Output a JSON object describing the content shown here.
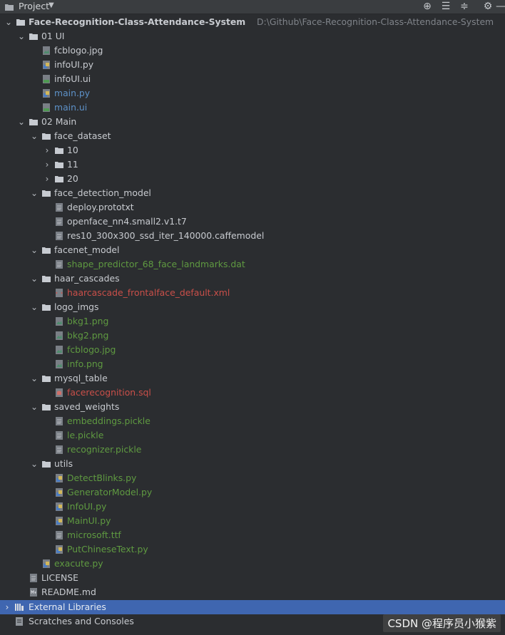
{
  "header": {
    "title": "Project"
  },
  "colors": {
    "background": "#2b2d30",
    "selection": "#3f66b0",
    "green": "#5f9a41",
    "blue": "#5d91c8",
    "red": "#c94f49"
  },
  "tree": [
    {
      "label": "Face-Recognition-Class-Attendance-System",
      "path": "D:\\Github\\Face-Recognition-Class-Attendance-System",
      "indent": 0,
      "type": "folder",
      "arrow": "down",
      "bold": true,
      "color": "default",
      "icon": "folder-icon"
    },
    {
      "label": "01 UI",
      "indent": 1,
      "type": "folder",
      "arrow": "down",
      "color": "default",
      "icon": "folder-icon"
    },
    {
      "label": "fcblogo.jpg",
      "indent": 2,
      "type": "file",
      "color": "default",
      "icon": "image-file-icon"
    },
    {
      "label": "infoUI.py",
      "indent": 2,
      "type": "file",
      "color": "default",
      "icon": "python-file-icon"
    },
    {
      "label": "infoUI.ui",
      "indent": 2,
      "type": "file",
      "color": "default",
      "icon": "ui-file-icon"
    },
    {
      "label": "main.py",
      "indent": 2,
      "type": "file",
      "color": "blue",
      "icon": "python-file-icon"
    },
    {
      "label": "main.ui",
      "indent": 2,
      "type": "file",
      "color": "blue",
      "icon": "ui-file-icon"
    },
    {
      "label": "02 Main",
      "indent": 1,
      "type": "folder",
      "arrow": "down",
      "color": "default",
      "icon": "folder-icon"
    },
    {
      "label": "face_dataset",
      "indent": 2,
      "type": "folder",
      "arrow": "down",
      "color": "default",
      "icon": "folder-icon"
    },
    {
      "label": "10",
      "indent": 3,
      "type": "folder",
      "arrow": "right",
      "color": "default",
      "icon": "folder-icon"
    },
    {
      "label": "11",
      "indent": 3,
      "type": "folder",
      "arrow": "right",
      "color": "default",
      "icon": "folder-icon"
    },
    {
      "label": "20",
      "indent": 3,
      "type": "folder",
      "arrow": "right",
      "color": "default",
      "icon": "folder-icon"
    },
    {
      "label": "face_detection_model",
      "indent": 2,
      "type": "folder",
      "arrow": "down",
      "color": "default",
      "icon": "folder-icon"
    },
    {
      "label": "deploy.prototxt",
      "indent": 3,
      "type": "file",
      "color": "default",
      "icon": "text-file-icon"
    },
    {
      "label": "openface_nn4.small2.v1.t7",
      "indent": 3,
      "type": "file",
      "color": "default",
      "icon": "text-file-icon"
    },
    {
      "label": "res10_300x300_ssd_iter_140000.caffemodel",
      "indent": 3,
      "type": "file",
      "color": "default",
      "icon": "text-file-icon"
    },
    {
      "label": "facenet_model",
      "indent": 2,
      "type": "folder",
      "arrow": "down",
      "color": "default",
      "icon": "folder-icon"
    },
    {
      "label": "shape_predictor_68_face_landmarks.dat",
      "indent": 3,
      "type": "file",
      "color": "green",
      "icon": "text-file-icon"
    },
    {
      "label": "haar_cascades",
      "indent": 2,
      "type": "folder",
      "arrow": "down",
      "color": "default",
      "icon": "folder-icon"
    },
    {
      "label": "haarcascade_frontalface_default.xml",
      "indent": 3,
      "type": "file",
      "color": "red",
      "icon": "xml-file-icon"
    },
    {
      "label": "logo_imgs",
      "indent": 2,
      "type": "folder",
      "arrow": "down",
      "color": "default",
      "icon": "folder-icon"
    },
    {
      "label": "bkg1.png",
      "indent": 3,
      "type": "file",
      "color": "green",
      "icon": "image-file-icon"
    },
    {
      "label": "bkg2.png",
      "indent": 3,
      "type": "file",
      "color": "green",
      "icon": "image-file-icon"
    },
    {
      "label": "fcblogo.jpg",
      "indent": 3,
      "type": "file",
      "color": "green",
      "icon": "image-file-icon"
    },
    {
      "label": "info.png",
      "indent": 3,
      "type": "file",
      "color": "green",
      "icon": "image-file-icon"
    },
    {
      "label": "mysql_table",
      "indent": 2,
      "type": "folder",
      "arrow": "down",
      "color": "default",
      "icon": "folder-icon"
    },
    {
      "label": "facerecognition.sql",
      "indent": 3,
      "type": "file",
      "color": "red",
      "icon": "sql-file-icon"
    },
    {
      "label": "saved_weights",
      "indent": 2,
      "type": "folder",
      "arrow": "down",
      "color": "default",
      "icon": "folder-icon"
    },
    {
      "label": "embeddings.pickle",
      "indent": 3,
      "type": "file",
      "color": "green",
      "icon": "text-file-icon"
    },
    {
      "label": "le.pickle",
      "indent": 3,
      "type": "file",
      "color": "green",
      "icon": "text-file-icon"
    },
    {
      "label": "recognizer.pickle",
      "indent": 3,
      "type": "file",
      "color": "green",
      "icon": "text-file-icon"
    },
    {
      "label": "utils",
      "indent": 2,
      "type": "folder",
      "arrow": "down",
      "color": "default",
      "icon": "folder-icon"
    },
    {
      "label": "DetectBlinks.py",
      "indent": 3,
      "type": "file",
      "color": "green",
      "icon": "python-file-icon"
    },
    {
      "label": "GeneratorModel.py",
      "indent": 3,
      "type": "file",
      "color": "green",
      "icon": "python-file-icon"
    },
    {
      "label": "InfoUI.py",
      "indent": 3,
      "type": "file",
      "color": "green",
      "icon": "python-file-icon"
    },
    {
      "label": "MainUI.py",
      "indent": 3,
      "type": "file",
      "color": "green",
      "icon": "python-file-icon"
    },
    {
      "label": "microsoft.ttf",
      "indent": 3,
      "type": "file",
      "color": "green",
      "icon": "text-file-icon"
    },
    {
      "label": "PutChineseText.py",
      "indent": 3,
      "type": "file",
      "color": "green",
      "icon": "python-file-icon"
    },
    {
      "label": "exacute.py",
      "indent": 2,
      "type": "file",
      "color": "green",
      "icon": "python-file-icon"
    },
    {
      "label": "LICENSE",
      "indent": 1,
      "type": "file",
      "color": "default",
      "icon": "text-file-icon"
    },
    {
      "label": "README.md",
      "indent": 1,
      "type": "file",
      "color": "default",
      "icon": "markdown-file-icon"
    }
  ],
  "footer": {
    "external_libraries": "External Libraries",
    "scratches": "Scratches and Consoles"
  },
  "watermark": "CSDN @程序员小猴紫"
}
